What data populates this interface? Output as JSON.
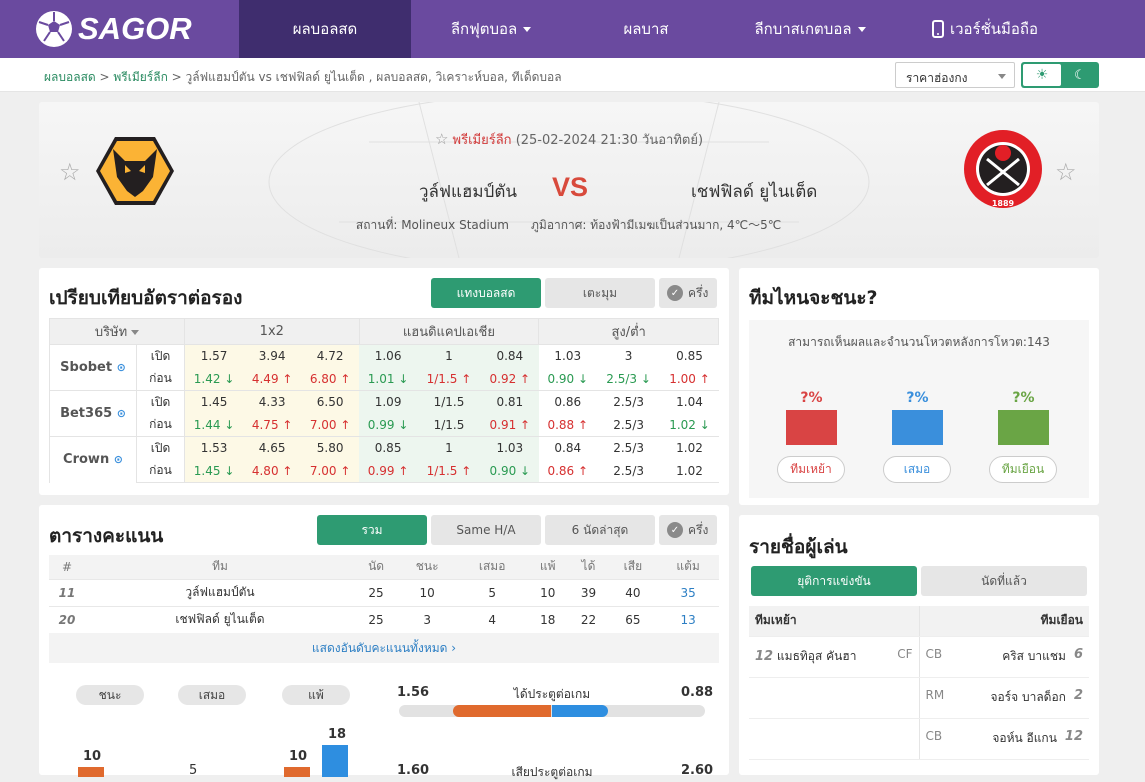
{
  "header": {
    "logo": "SAGOR",
    "nav": [
      "ผลบอลสด",
      "ลีกฟุตบอล",
      "ผลบาส",
      "ลีกบาสเกตบอล",
      "เวอร์ชั่นมือถือ"
    ]
  },
  "breadcrumb": {
    "home": "ผลบอลสด",
    "league": "พรีเมียร์ลีก",
    "page": "วูล์ฟแฮมป์ตัน vs เชฟฟิลด์ ยูไนเต็ด , ผลบอลสด, วิเคราะห์บอล, ทีเด็ดบอล"
  },
  "odds_select": "ราคาฮ่องกง",
  "match": {
    "league": "พรีเมียร์ลีก",
    "datetime": "(25-02-2024 21:30 วันอาทิตย์)",
    "home": "วูล์ฟแฮมป์ตัน",
    "away": "เชฟฟิลด์ ยูไนเต็ด",
    "vs": "VS",
    "stadium": "สถานที่: Molineux Stadium",
    "weather": "ภูมิอากาศ: ท้องฟ้ามีเมฆเป็นส่วนมาก, 4℃～5℃",
    "away_badge_year": "1889"
  },
  "odds": {
    "title": "เปรียบเทียบอัตราต่อรอง",
    "tabs": [
      "แทงบอลสด",
      "เตะมุม"
    ],
    "half": "ครึ่ง",
    "headers": [
      "บริษัท",
      "1x2",
      "แฮนดิแคปเอเชีย",
      "สูง/ต่ำ"
    ],
    "open": "เปิด",
    "before": "ก่อน",
    "rows": [
      {
        "name": "Sbobet",
        "o": [
          "1.57",
          "3.94",
          "4.72",
          "1.06",
          "1",
          "0.84",
          "1.03",
          "3",
          "0.85"
        ],
        "c": [
          "1.42",
          "4.49",
          "6.80",
          "1.01",
          "1/1.5",
          "0.92",
          "0.90",
          "2.5/3",
          "1.00"
        ],
        "d": [
          "dn",
          "up",
          "up",
          "dn",
          "up",
          "up",
          "dn",
          "dn",
          "up"
        ]
      },
      {
        "name": "Bet365",
        "o": [
          "1.45",
          "4.33",
          "6.50",
          "1.09",
          "1/1.5",
          "0.81",
          "0.86",
          "2.5/3",
          "1.04"
        ],
        "c": [
          "1.44",
          "4.75",
          "7.00",
          "0.99",
          "1/1.5",
          "0.91",
          "0.88",
          "2.5/3",
          "1.02"
        ],
        "d": [
          "dn",
          "up",
          "up",
          "dn",
          "",
          "up",
          "up",
          "",
          "dn"
        ]
      },
      {
        "name": "Crown",
        "o": [
          "1.53",
          "4.65",
          "5.80",
          "0.85",
          "1",
          "1.03",
          "0.84",
          "2.5/3",
          "1.02"
        ],
        "c": [
          "1.45",
          "4.80",
          "7.00",
          "0.99",
          "1/1.5",
          "0.90",
          "0.86",
          "2.5/3",
          "1.02"
        ],
        "d": [
          "dn",
          "up",
          "up",
          "up",
          "up",
          "dn",
          "up",
          "",
          ""
        ]
      }
    ]
  },
  "standings": {
    "title": "ตารางคะแนน",
    "tabs": [
      "รวม",
      "Same H/A",
      "6 นัดล่าสุด"
    ],
    "half": "ครึ่ง",
    "headers": [
      "#",
      "ทีม",
      "นัด",
      "ชนะ",
      "เสมอ",
      "แพ้",
      "ได้",
      "เสีย",
      "แต้ม"
    ],
    "rows": [
      [
        "11",
        "วูล์ฟแฮมป์ตัน",
        "25",
        "10",
        "5",
        "10",
        "39",
        "40",
        "35"
      ],
      [
        "20",
        "เชฟฟิลด์ ยูไนเต็ด",
        "25",
        "3",
        "4",
        "18",
        "22",
        "65",
        "13"
      ]
    ],
    "more": "แสดงอันดับคะแนนทั้งหมด"
  },
  "stats": {
    "pills": [
      "ชนะ",
      "เสมอ",
      "แพ้"
    ],
    "goal_label": "ได้ประตูต่อเกม",
    "goal_home": "1.56",
    "goal_away": "0.88",
    "bars": [
      "10",
      "5",
      "10",
      "18"
    ],
    "row2_label": "เสียประตูต่อเกม",
    "row2_home": "1.60",
    "row2_away": "2.60"
  },
  "vote": {
    "title": "ทีมไหนจะชนะ?",
    "desc": "สามารถเห็นผลและจำนวนโหวตหลังการโหวต:143",
    "pcts": [
      "?%",
      "?%",
      "?%"
    ],
    "buttons": [
      "ทีมเหย้า",
      "เสมอ",
      "ทีมเยือน"
    ],
    "colors": [
      "#d94444",
      "#3a8fdc",
      "#6aa545"
    ]
  },
  "players": {
    "title": "รายชื่อผู้เล่น",
    "tabs": [
      "ยุติการแข่งขัน",
      "นัดที่แล้ว"
    ],
    "home_label": "ทีมเหย้า",
    "away_label": "ทีมเยือน",
    "rows": [
      {
        "hn": "12",
        "hname": "แมธทิอุส คันฮา",
        "hpos": "CF",
        "apos": "CB",
        "aname": "คริส บาแชม",
        "an": "6"
      },
      {
        "hn": "",
        "hname": "",
        "hpos": "",
        "apos": "RM",
        "aname": "จอร์จ บาลด็อก",
        "an": "2"
      },
      {
        "hn": "",
        "hname": "",
        "hpos": "",
        "apos": "CB",
        "aname": "จอห์น อีแกน",
        "an": "12"
      }
    ]
  }
}
